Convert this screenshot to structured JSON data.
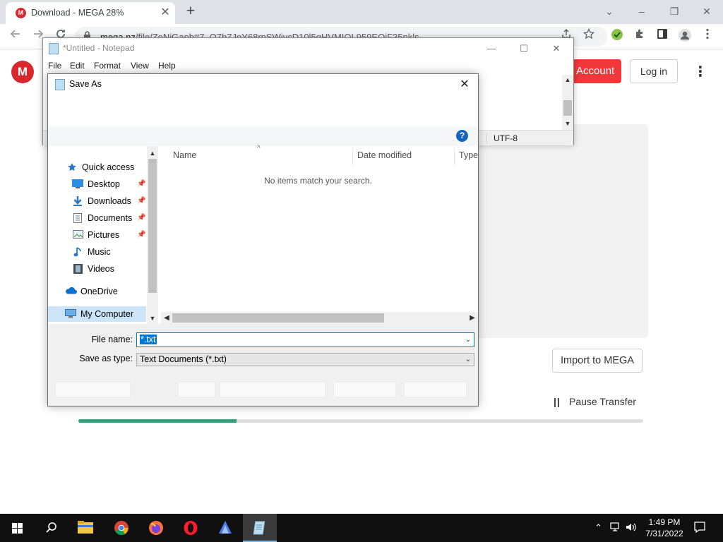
{
  "browser": {
    "tab_title": "Download - MEGA 28%",
    "tab_close": "✕",
    "new_tab": "+",
    "url_host": "mega.nz",
    "url_path": "/file/ZoNjGaob#7_O7b7JoY68rpSWivcD10l5gHVMIOL959EOjF35nkls",
    "window_controls": {
      "minimize": "⌄",
      "restore": "–",
      "maximize": "❐",
      "close": "✕"
    }
  },
  "mega": {
    "logo": "M",
    "account_label": "Account",
    "login_label": "Log in",
    "menu": "⋮",
    "import_label": "Import to MEGA",
    "pause_label": "Pause Transfer",
    "progress": 0.28,
    "brand_color": "#d9272e",
    "progress_color": "#31a27b"
  },
  "notepad": {
    "title": "*Untitled - Notepad",
    "menu": [
      "File",
      "Edit",
      "Format",
      "View",
      "Help"
    ],
    "encoding": "UTF-8",
    "controls": {
      "minimize": "—",
      "maximize": "☐",
      "close": "✕"
    }
  },
  "save_as": {
    "title": "Save As",
    "close": "✕",
    "help": "?",
    "nav": {
      "quick_access": "Quick access",
      "desktop": "Desktop",
      "downloads": "Downloads",
      "documents": "Documents",
      "pictures": "Pictures",
      "music": "Music",
      "videos": "Videos",
      "onedrive": "OneDrive",
      "my_computer": "My Computer"
    },
    "columns": {
      "name": "Name",
      "date_modified": "Date modified",
      "type": "Type"
    },
    "empty_message": "No items match your search.",
    "file_name_label": "File name:",
    "file_name_value": "*.txt",
    "save_type_label": "Save as type:",
    "save_type_value": "Text Documents (*.txt)"
  },
  "taskbar": {
    "time": "1:49 PM",
    "date": "7/31/2022"
  }
}
